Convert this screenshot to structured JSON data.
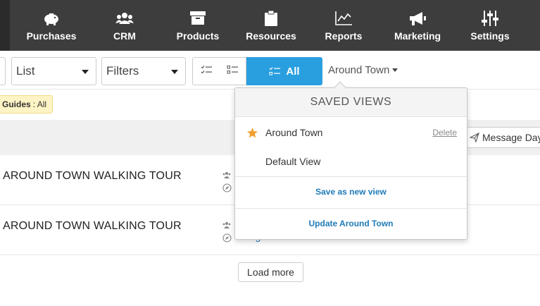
{
  "nav": {
    "items": [
      {
        "label": "Purchases",
        "icon": "piggy-bank-icon"
      },
      {
        "label": "CRM",
        "icon": "people-icon"
      },
      {
        "label": "Products",
        "icon": "archive-box-icon"
      },
      {
        "label": "Resources",
        "icon": "clipboard-icon"
      },
      {
        "label": "Reports",
        "icon": "line-chart-icon"
      },
      {
        "label": "Marketing",
        "icon": "megaphone-icon"
      },
      {
        "label": "Settings",
        "icon": "sliders-icon"
      }
    ]
  },
  "toolbar": {
    "list_select": "List",
    "filters_select": "Filters",
    "all_label": "All",
    "current_view": "Around Town"
  },
  "filter_chip": {
    "key": "Guides",
    "value": ": All"
  },
  "header": {
    "message_button": "Message Day's"
  },
  "rows": [
    {
      "title": "AROUND TOWN WALKING TOUR"
    },
    {
      "title": "AROUND TOWN WALKING TOUR",
      "assign_link": "Assign Guides"
    }
  ],
  "load_more": "Load more",
  "dropdown": {
    "title": "SAVED VIEWS",
    "views": [
      {
        "label": "Around Town",
        "starred": true,
        "delete_label": "Delete"
      },
      {
        "label": "Default View",
        "starred": false
      }
    ],
    "save_new": "Save as new view",
    "update": "Update Around Town"
  },
  "colors": {
    "nav_bg": "#3d3d3d",
    "accent": "#2a9fe0",
    "link": "#1f7ab8",
    "star": "#f0a030",
    "chip_bg": "#fdf3c4"
  }
}
